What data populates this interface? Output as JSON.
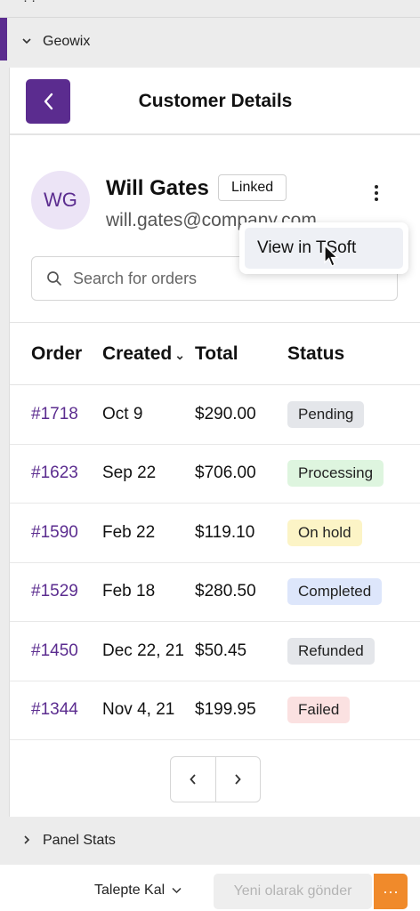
{
  "top_cut": {
    "label": "· ·"
  },
  "sections": {
    "geowix": "Geowix",
    "panel_stats": "Panel Stats"
  },
  "customer_details": {
    "title": "Customer Details",
    "customer": {
      "initials": "WG",
      "name": "Will Gates",
      "linked_label": "Linked",
      "email": "will.gates@company.com"
    },
    "menu": {
      "view_in": "View in TSoft"
    },
    "search": {
      "placeholder": "Search for orders"
    },
    "table": {
      "headers": {
        "order": "Order",
        "created": "Created",
        "total": "Total",
        "status": "Status"
      },
      "rows": [
        {
          "order": "#1718",
          "created": "Oct 9",
          "total": "$290.00",
          "status": "Pending",
          "status_bg": "#e4e6ea"
        },
        {
          "order": "#1623",
          "created": "Sep 22",
          "total": "$706.00",
          "status": "Processing",
          "status_bg": "#def5df"
        },
        {
          "order": "#1590",
          "created": "Feb 22",
          "total": "$119.10",
          "status": "On hold",
          "status_bg": "#fcf4c6"
        },
        {
          "order": "#1529",
          "created": "Feb 18",
          "total": "$280.50",
          "status": "Completed",
          "status_bg": "#dde6fb"
        },
        {
          "order": "#1450",
          "created": "Dec 22, 21",
          "total": "$50.45",
          "status": "Refunded",
          "status_bg": "#e4e6ea"
        },
        {
          "order": "#1344",
          "created": "Nov 4, 21",
          "total": "$199.95",
          "status": "Failed",
          "status_bg": "#fbe1e1"
        }
      ]
    }
  },
  "footer": {
    "talepte": "Talepte Kal",
    "send": "Yeni olarak gönder"
  },
  "colors": {
    "brand": "#5b2c8f",
    "accent_orange": "#f08a2b"
  }
}
